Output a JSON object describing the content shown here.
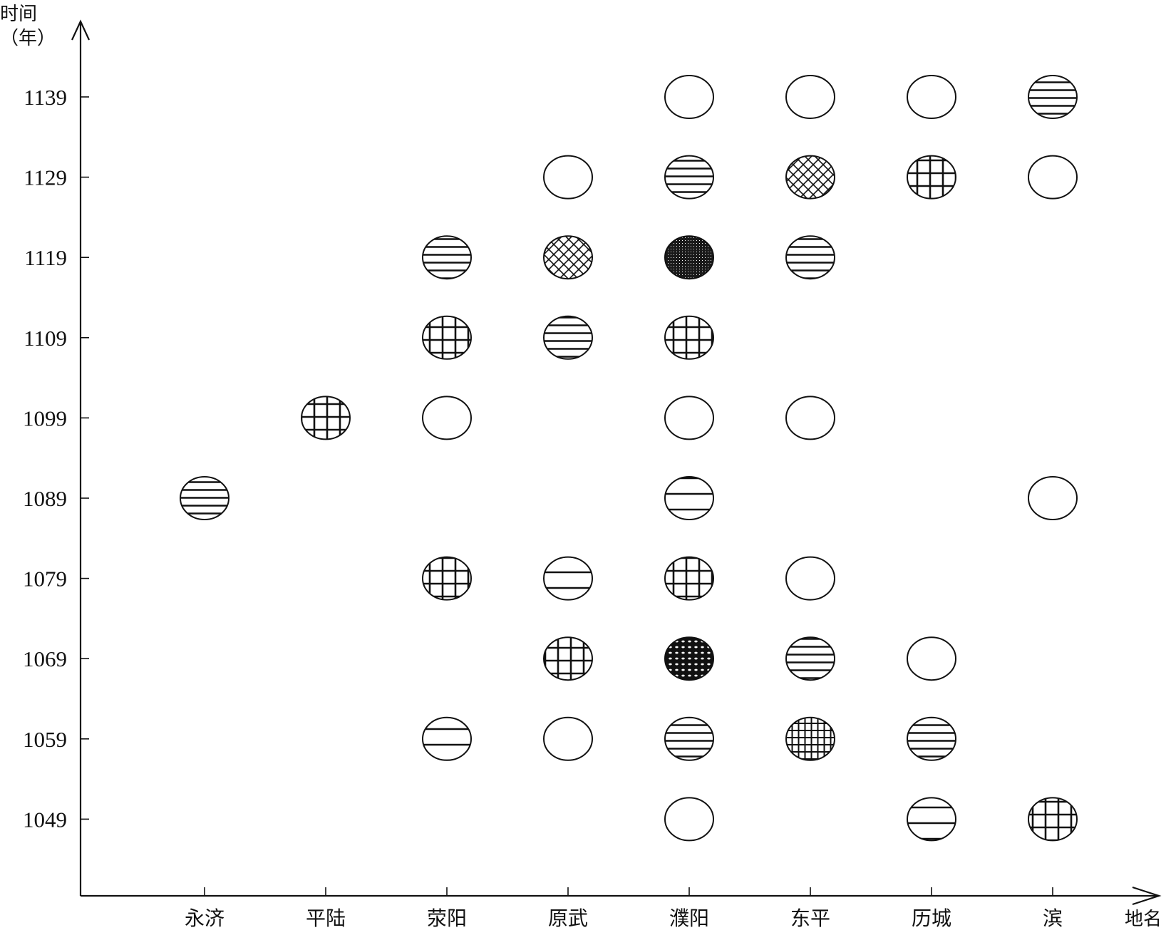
{
  "chart_data": {
    "type": "scatter",
    "title": "",
    "xlabel": "地名",
    "ylabel": "时间（年）",
    "ylabel_lines": [
      "时间",
      "（年）"
    ],
    "categories": [
      "永济",
      "平陆",
      "荥阳",
      "原武",
      "濮阳",
      "东平",
      "历城",
      "滨"
    ],
    "y_ticks": [
      1139,
      1129,
      1119,
      1109,
      1099,
      1089,
      1079,
      1069,
      1059,
      1049
    ],
    "ylim": [
      1049,
      1139
    ],
    "grid": false,
    "legend": null,
    "marker_patterns": [
      "empty",
      "horizontal-lines-dense",
      "horizontal-lines-sparse",
      "grid",
      "grid-dense",
      "crosshatch",
      "stipple-dark",
      "dots-dark"
    ],
    "points": [
      {
        "place": "濮阳",
        "year": 1139,
        "pattern": "empty"
      },
      {
        "place": "东平",
        "year": 1139,
        "pattern": "empty"
      },
      {
        "place": "历城",
        "year": 1139,
        "pattern": "empty"
      },
      {
        "place": "滨",
        "year": 1139,
        "pattern": "horizontal-lines-dense"
      },
      {
        "place": "原武",
        "year": 1129,
        "pattern": "empty"
      },
      {
        "place": "濮阳",
        "year": 1129,
        "pattern": "horizontal-lines-dense"
      },
      {
        "place": "东平",
        "year": 1129,
        "pattern": "crosshatch"
      },
      {
        "place": "历城",
        "year": 1129,
        "pattern": "grid"
      },
      {
        "place": "滨",
        "year": 1129,
        "pattern": "empty"
      },
      {
        "place": "荥阳",
        "year": 1119,
        "pattern": "horizontal-lines-dense"
      },
      {
        "place": "原武",
        "year": 1119,
        "pattern": "crosshatch"
      },
      {
        "place": "濮阳",
        "year": 1119,
        "pattern": "stipple-dark"
      },
      {
        "place": "东平",
        "year": 1119,
        "pattern": "horizontal-lines-dense"
      },
      {
        "place": "荥阳",
        "year": 1109,
        "pattern": "grid"
      },
      {
        "place": "原武",
        "year": 1109,
        "pattern": "horizontal-lines-dense"
      },
      {
        "place": "濮阳",
        "year": 1109,
        "pattern": "grid"
      },
      {
        "place": "平陆",
        "year": 1099,
        "pattern": "grid"
      },
      {
        "place": "荥阳",
        "year": 1099,
        "pattern": "empty"
      },
      {
        "place": "濮阳",
        "year": 1099,
        "pattern": "empty"
      },
      {
        "place": "东平",
        "year": 1099,
        "pattern": "empty"
      },
      {
        "place": "永济",
        "year": 1089,
        "pattern": "horizontal-lines-dense"
      },
      {
        "place": "濮阳",
        "year": 1089,
        "pattern": "horizontal-lines-sparse"
      },
      {
        "place": "滨",
        "year": 1089,
        "pattern": "empty"
      },
      {
        "place": "荥阳",
        "year": 1079,
        "pattern": "grid"
      },
      {
        "place": "原武",
        "year": 1079,
        "pattern": "horizontal-lines-sparse"
      },
      {
        "place": "濮阳",
        "year": 1079,
        "pattern": "grid"
      },
      {
        "place": "东平",
        "year": 1079,
        "pattern": "empty"
      },
      {
        "place": "原武",
        "year": 1069,
        "pattern": "grid"
      },
      {
        "place": "濮阳",
        "year": 1069,
        "pattern": "dots-dark"
      },
      {
        "place": "东平",
        "year": 1069,
        "pattern": "horizontal-lines-dense"
      },
      {
        "place": "历城",
        "year": 1069,
        "pattern": "empty"
      },
      {
        "place": "荥阳",
        "year": 1059,
        "pattern": "horizontal-lines-sparse"
      },
      {
        "place": "原武",
        "year": 1059,
        "pattern": "empty"
      },
      {
        "place": "濮阳",
        "year": 1059,
        "pattern": "horizontal-lines-dense"
      },
      {
        "place": "东平",
        "year": 1059,
        "pattern": "grid-dense"
      },
      {
        "place": "历城",
        "year": 1059,
        "pattern": "horizontal-lines-dense"
      },
      {
        "place": "濮阳",
        "year": 1049,
        "pattern": "empty"
      },
      {
        "place": "历城",
        "year": 1049,
        "pattern": "horizontal-lines-sparse"
      },
      {
        "place": "滨",
        "year": 1049,
        "pattern": "grid"
      }
    ]
  }
}
